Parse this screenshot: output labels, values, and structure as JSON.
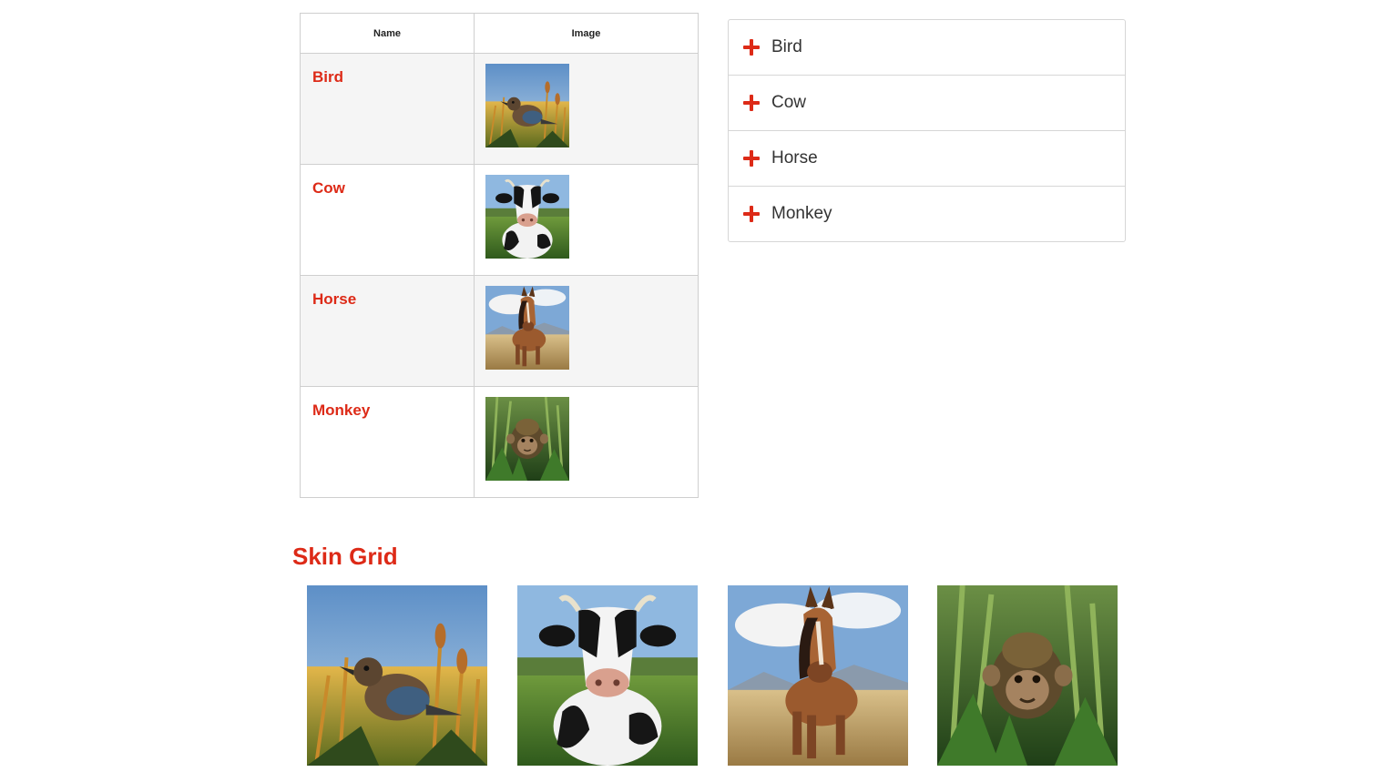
{
  "table": {
    "headers": {
      "name": "Name",
      "image": "Image"
    },
    "rows": [
      {
        "name": "Bird",
        "image_icon": "bird-image"
      },
      {
        "name": "Cow",
        "image_icon": "cow-image"
      },
      {
        "name": "Horse",
        "image_icon": "horse-image"
      },
      {
        "name": "Monkey",
        "image_icon": "monkey-image"
      }
    ]
  },
  "accordion": {
    "items": [
      {
        "label": "Bird",
        "icon": "plus-icon"
      },
      {
        "label": "Cow",
        "icon": "plus-icon"
      },
      {
        "label": "Horse",
        "icon": "plus-icon"
      },
      {
        "label": "Monkey",
        "icon": "plus-icon"
      }
    ]
  },
  "grid": {
    "title": "Skin Grid",
    "images": [
      "bird-image",
      "cow-image",
      "horse-image",
      "monkey-image"
    ]
  },
  "colors": {
    "accent": "#dd2a17",
    "border": "#cfcfcf",
    "row_alt": "#f5f5f5",
    "text": "#333333"
  }
}
